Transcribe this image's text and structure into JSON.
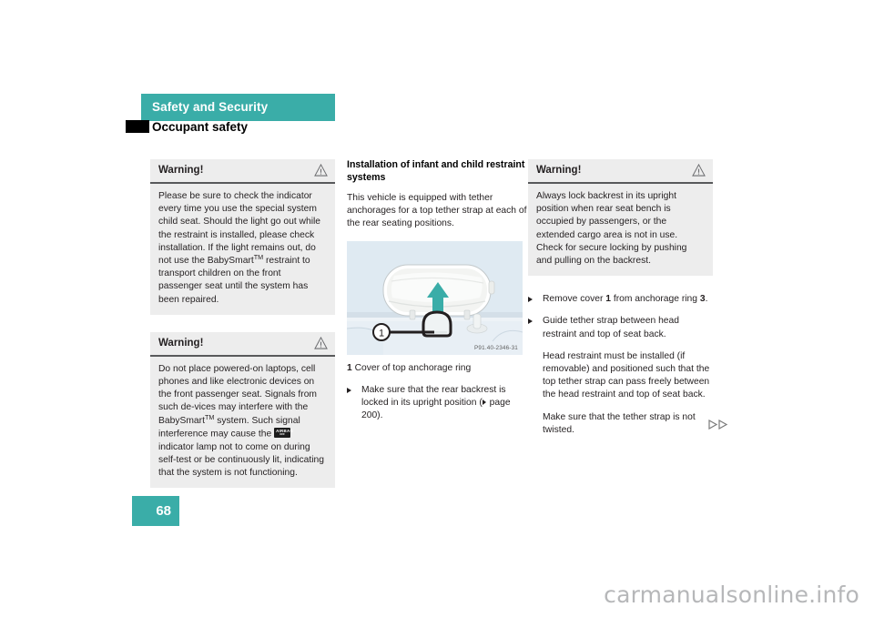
{
  "header": {
    "band_title": "Safety and Security",
    "section_title": "Occupant safety",
    "band_color": "#3aada8"
  },
  "left_column": {
    "warnings": [
      {
        "title": "Warning!",
        "icon": "warning-triangle-icon",
        "text_parts": {
          "a": "Please be sure to check the indicator every time you use the special system child seat. Should the light go out while the restraint is installed, please check installation. If the light remains out, do not use the BabySmart",
          "tm": "TM",
          "b": " restraint to transport children on the front passenger seat until the system has been repaired."
        }
      },
      {
        "title": "Warning!",
        "icon": "warning-triangle-icon",
        "text_parts": {
          "a": "Do not place powered-on laptops, cell phones and like electronic devices on the front passenger seat. Signals from such de-vices may interfere with the BabySmart",
          "tm": "TM",
          "b": " system. Such signal interference may cause the ",
          "badge_main": "AIRBAG",
          "badge_sub": "OFF",
          "c": " indicator lamp not to come on during self-test or be continuously lit, indicating that the system is not functioning."
        }
      }
    ]
  },
  "middle_column": {
    "heading": "Installation of infant and child restraint systems",
    "intro": "This vehicle is equipped with tether anchorages for a top tether strap at each of the rear seating positions.",
    "figure": {
      "code": "P91.40-2346-31",
      "callout": "1",
      "alt": "rear seat head restraint with top anchorage ring cover and upward arrow"
    },
    "caption_number": "1",
    "caption_text": "Cover of top anchorage ring",
    "bullets": [
      {
        "text_a": "Make sure that the rear backrest is locked in its upright position (",
        "ref": " page 200).",
        "text_b": ""
      }
    ]
  },
  "right_column": {
    "warning": {
      "title": "Warning!",
      "icon": "warning-triangle-icon",
      "text": "Always lock backrest in its upright position when rear seat bench is occupied by passengers, or the extended cargo area is not in use. Check for secure locking by pushing and pulling on the backrest."
    },
    "bullets": [
      {
        "a": "Remove cover ",
        "n1": "1",
        "b": " from anchorage ring ",
        "n2": "3",
        "c": "."
      },
      {
        "a": "Guide tether strap between head restraint and top of seat back.",
        "n1": "",
        "b": "",
        "n2": "",
        "c": ""
      }
    ],
    "paragraphs": [
      "Head restraint must be installed (if removable) and positioned such that the top tether strap can pass freely between the head restraint and top of seat back.",
      "Make sure that the tether strap is not twisted."
    ]
  },
  "footer": {
    "page_number": "68",
    "continuation_marker": "double-right-triangle",
    "watermark": "carmanualsonline.info"
  }
}
